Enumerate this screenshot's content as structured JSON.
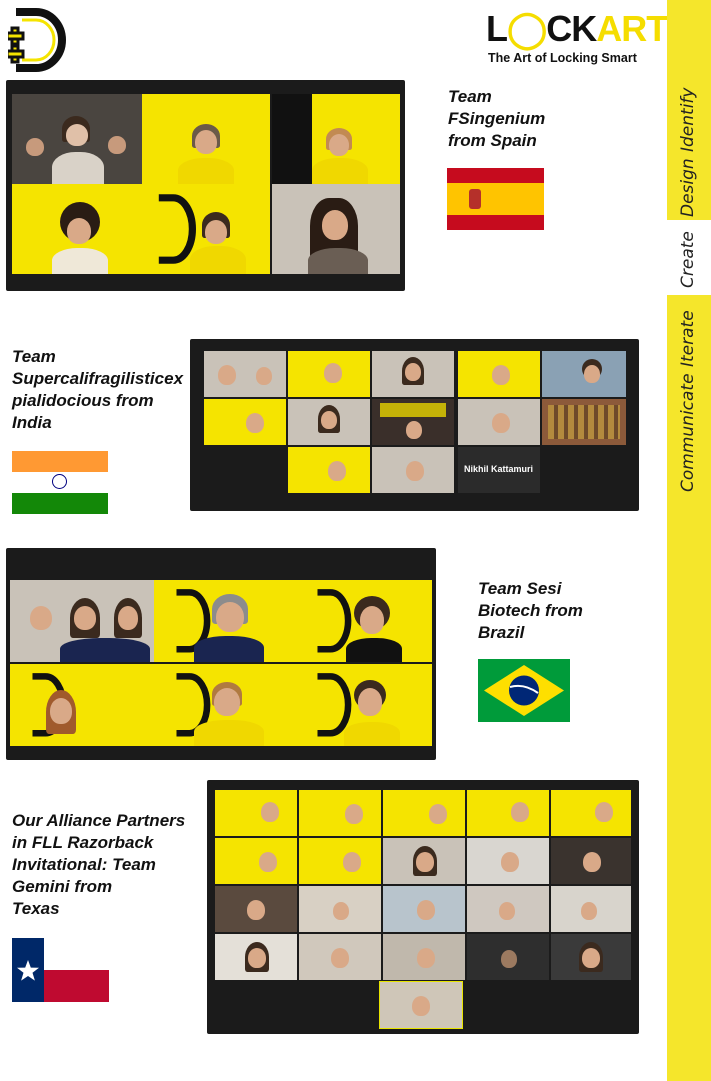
{
  "logo": {
    "icon": "d-plus-logo"
  },
  "lockart": {
    "title_a": "L",
    "title_b": "CK",
    "title_c": "ART",
    "tagline": "The Art of Locking Smart"
  },
  "process_bar": {
    "words": [
      "Identify",
      "Design",
      "Create",
      "Iterate",
      "Communicate"
    ],
    "color": "#f5e62b"
  },
  "teams": [
    {
      "label": "Team\nFSingenium\nfrom Spain",
      "flag": "spain-flag"
    },
    {
      "label": "Team\nSupercalifragilisticex\npialidocious from\nIndia",
      "flag": "india-flag",
      "tile_name": "Nikhil Kattamuri"
    },
    {
      "label": "Team Sesi\nBiotech from\nBrazil",
      "flag": "brazil-flag"
    },
    {
      "label": "Our Alliance Partners\nin FLL Razorback\nInvitational: Team\nGemini from\nTexas",
      "flag": "texas-flag"
    }
  ],
  "colors": {
    "brand_yellow": "#f5e400",
    "zoom_bg": "#1b1b1b"
  }
}
